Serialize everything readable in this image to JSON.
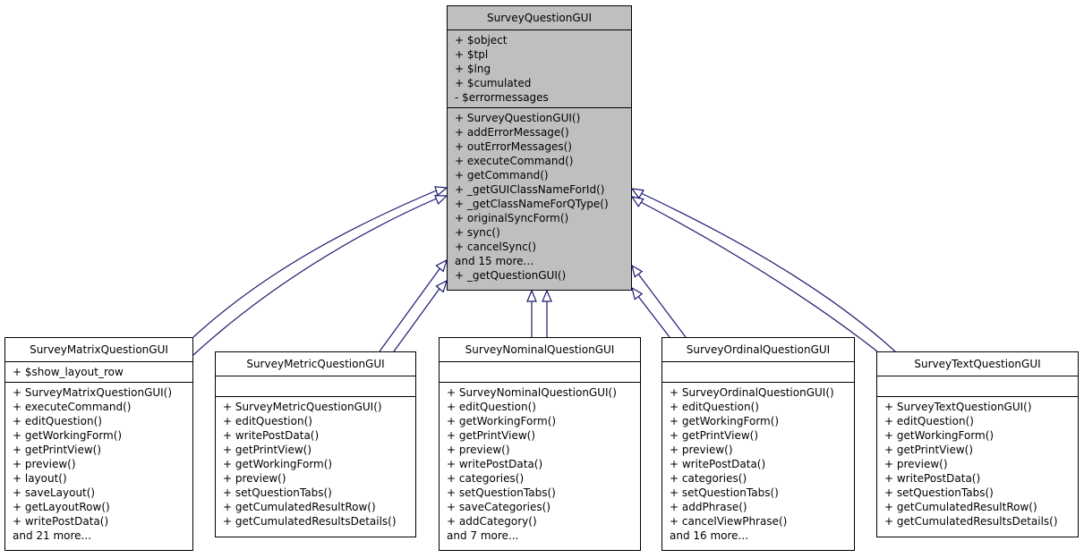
{
  "diagram": {
    "type": "uml-class-inheritance",
    "edge_color": "#191970",
    "base_fill": "#bfbfbf",
    "base_class": {
      "name": "SurveyQuestionGUI",
      "attributes": [
        "+ $object",
        "+ $tpl",
        "+ $lng",
        "+ $cumulated",
        "- $errormessages"
      ],
      "methods": [
        "+ SurveyQuestionGUI()",
        "+ addErrorMessage()",
        "+ outErrorMessages()",
        "+ executeCommand()",
        "+ getCommand()",
        "+ _getGUIClassNameForId()",
        "+ _getClassNameForQType()",
        "+ originalSyncForm()",
        "+ sync()",
        "+ cancelSync()",
        "and 15 more...",
        "+ _getQuestionGUI()"
      ]
    },
    "subclasses": [
      {
        "name": "SurveyMatrixQuestionGUI",
        "attributes": [
          "+ $show_layout_row"
        ],
        "methods": [
          "+ SurveyMatrixQuestionGUI()",
          "+ executeCommand()",
          "+ editQuestion()",
          "+ getWorkingForm()",
          "+ getPrintView()",
          "+ preview()",
          "+ layout()",
          "+ saveLayout()",
          "+ getLayoutRow()",
          "+ writePostData()",
          "and 21 more..."
        ]
      },
      {
        "name": "SurveyMetricQuestionGUI",
        "attributes": [],
        "methods": [
          "+ SurveyMetricQuestionGUI()",
          "+ editQuestion()",
          "+ writePostData()",
          "+ getPrintView()",
          "+ getWorkingForm()",
          "+ preview()",
          "+ setQuestionTabs()",
          "+ getCumulatedResultRow()",
          "+ getCumulatedResultsDetails()"
        ]
      },
      {
        "name": "SurveyNominalQuestionGUI",
        "attributes": [],
        "methods": [
          "+ SurveyNominalQuestionGUI()",
          "+ editQuestion()",
          "+ getWorkingForm()",
          "+ getPrintView()",
          "+ preview()",
          "+ writePostData()",
          "+ categories()",
          "+ setQuestionTabs()",
          "+ saveCategories()",
          "+ addCategory()",
          "and 7 more..."
        ]
      },
      {
        "name": "SurveyOrdinalQuestionGUI",
        "attributes": [],
        "methods": [
          "+ SurveyOrdinalQuestionGUI()",
          "+ editQuestion()",
          "+ getWorkingForm()",
          "+ getPrintView()",
          "+ preview()",
          "+ writePostData()",
          "+ categories()",
          "+ setQuestionTabs()",
          "+ addPhrase()",
          "+ cancelViewPhrase()",
          "and 16 more..."
        ]
      },
      {
        "name": "SurveyTextQuestionGUI",
        "attributes": [],
        "methods": [
          "+ SurveyTextQuestionGUI()",
          "+ editQuestion()",
          "+ getWorkingForm()",
          "+ getPrintView()",
          "+ preview()",
          "+ writePostData()",
          "+ setQuestionTabs()",
          "+ getCumulatedResultRow()",
          "+ getCumulatedResultsDetails()"
        ]
      }
    ]
  }
}
